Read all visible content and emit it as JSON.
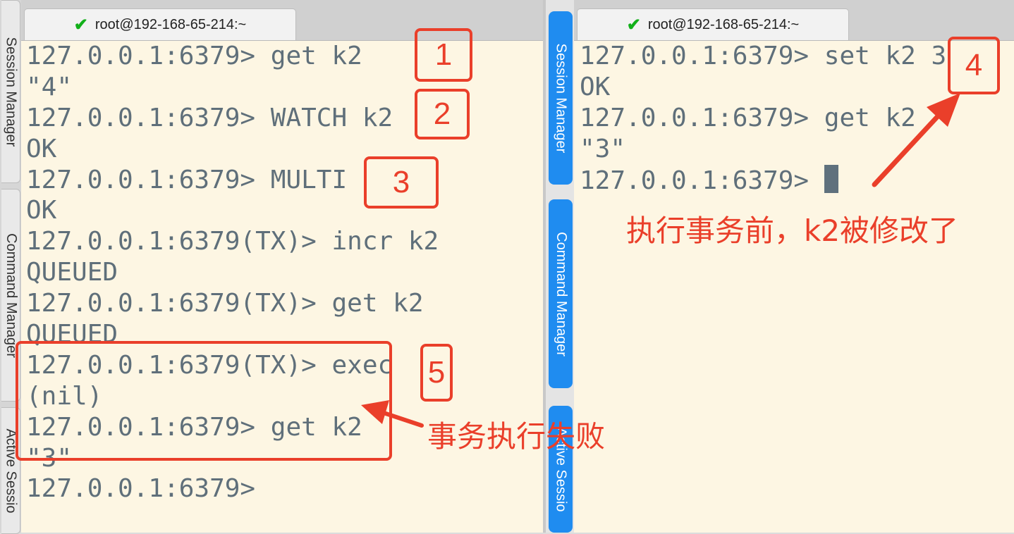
{
  "left_pane": {
    "side_tabs": [
      "Session Manager",
      "Command Manager",
      "Active Sessio"
    ],
    "tab_title": "root@192-168-65-214:~",
    "lines": [
      "127.0.0.1:6379> get k2",
      "\"4\"",
      "127.0.0.1:6379> WATCH k2",
      "OK",
      "127.0.0.1:6379> MULTI",
      "OK",
      "127.0.0.1:6379(TX)> incr k2",
      "QUEUED",
      "127.0.0.1:6379(TX)> get k2",
      "QUEUED",
      "127.0.0.1:6379(TX)> exec",
      "(nil)",
      "127.0.0.1:6379> get k2",
      "\"3\"",
      "127.0.0.1:6379>"
    ]
  },
  "right_pane": {
    "side_tabs": [
      "Session Manager",
      "Command Manager",
      "Active Sessio"
    ],
    "tab_title": "root@192-168-65-214:~",
    "lines": [
      "127.0.0.1:6379> set k2 3",
      "OK",
      "127.0.0.1:6379> get k2",
      "\"3\"",
      "127.0.0.1:6379> "
    ]
  },
  "annotations": {
    "step_numbers": [
      "1",
      "2",
      "3",
      "4",
      "5"
    ],
    "label_modified": "执行事务前，k2被修改了",
    "label_failed": "事务执行失败"
  },
  "colors": {
    "annotation": "#ea3f2a",
    "terminal_bg": "#fdf6e3",
    "terminal_text": "#5f6f7a",
    "tab_accent": "#1f8cf0",
    "check": "#12b01a"
  },
  "icons": {
    "tab_status": "checkmark-icon"
  }
}
